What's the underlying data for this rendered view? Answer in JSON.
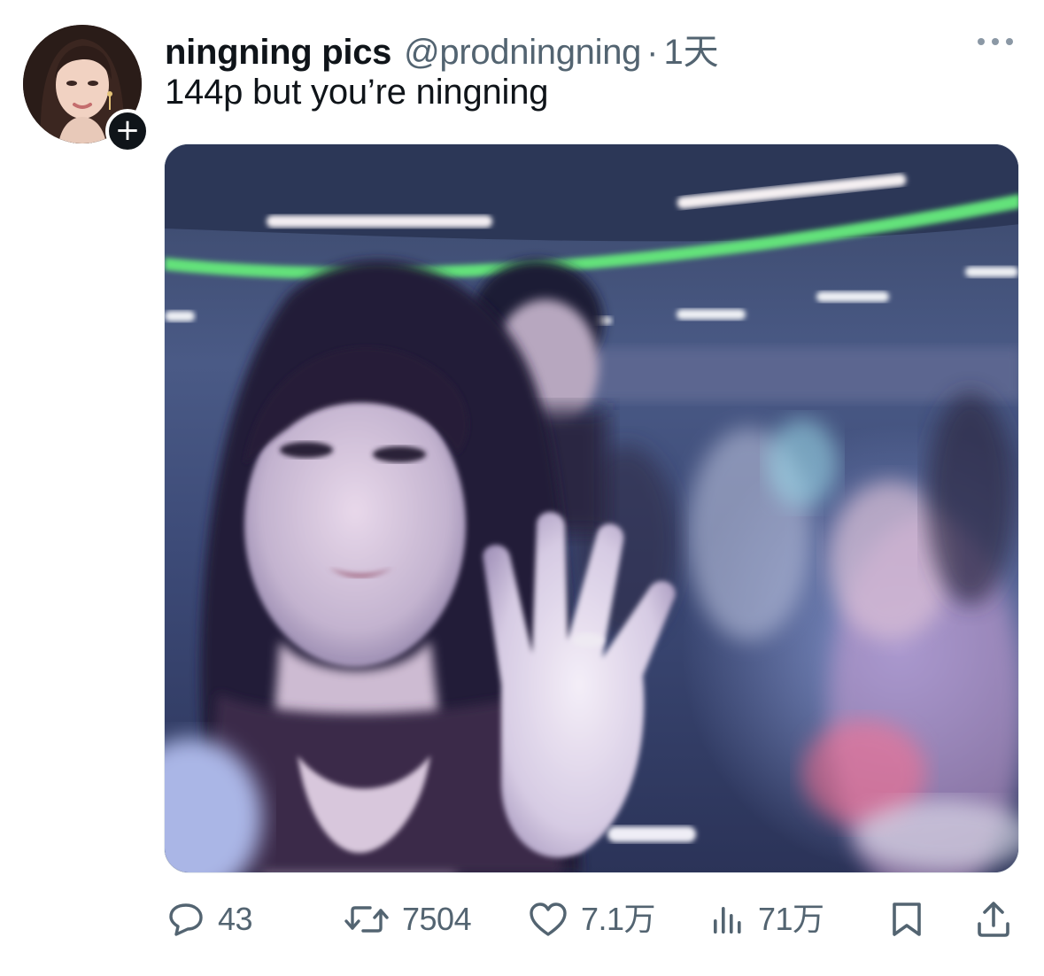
{
  "user": {
    "display_name": "ningning pics",
    "handle": "@prodningning",
    "separator": "·",
    "time": "1天",
    "follow_symbol": "+"
  },
  "tweet": {
    "text": "144p but you’re ningning"
  },
  "icons": {
    "more": "more-options-icon",
    "reply": "reply-icon",
    "retweet": "retweet-icon",
    "like": "heart-icon",
    "views": "analytics-icon",
    "bookmark": "bookmark-icon",
    "share": "share-icon"
  },
  "actions": {
    "reply_count": "43",
    "retweet_count": "7504",
    "like_count": "7.1万",
    "view_count": "71万"
  },
  "colors": {
    "text_primary": "#0f1419",
    "text_secondary": "#536471",
    "background": "#ffffff"
  }
}
